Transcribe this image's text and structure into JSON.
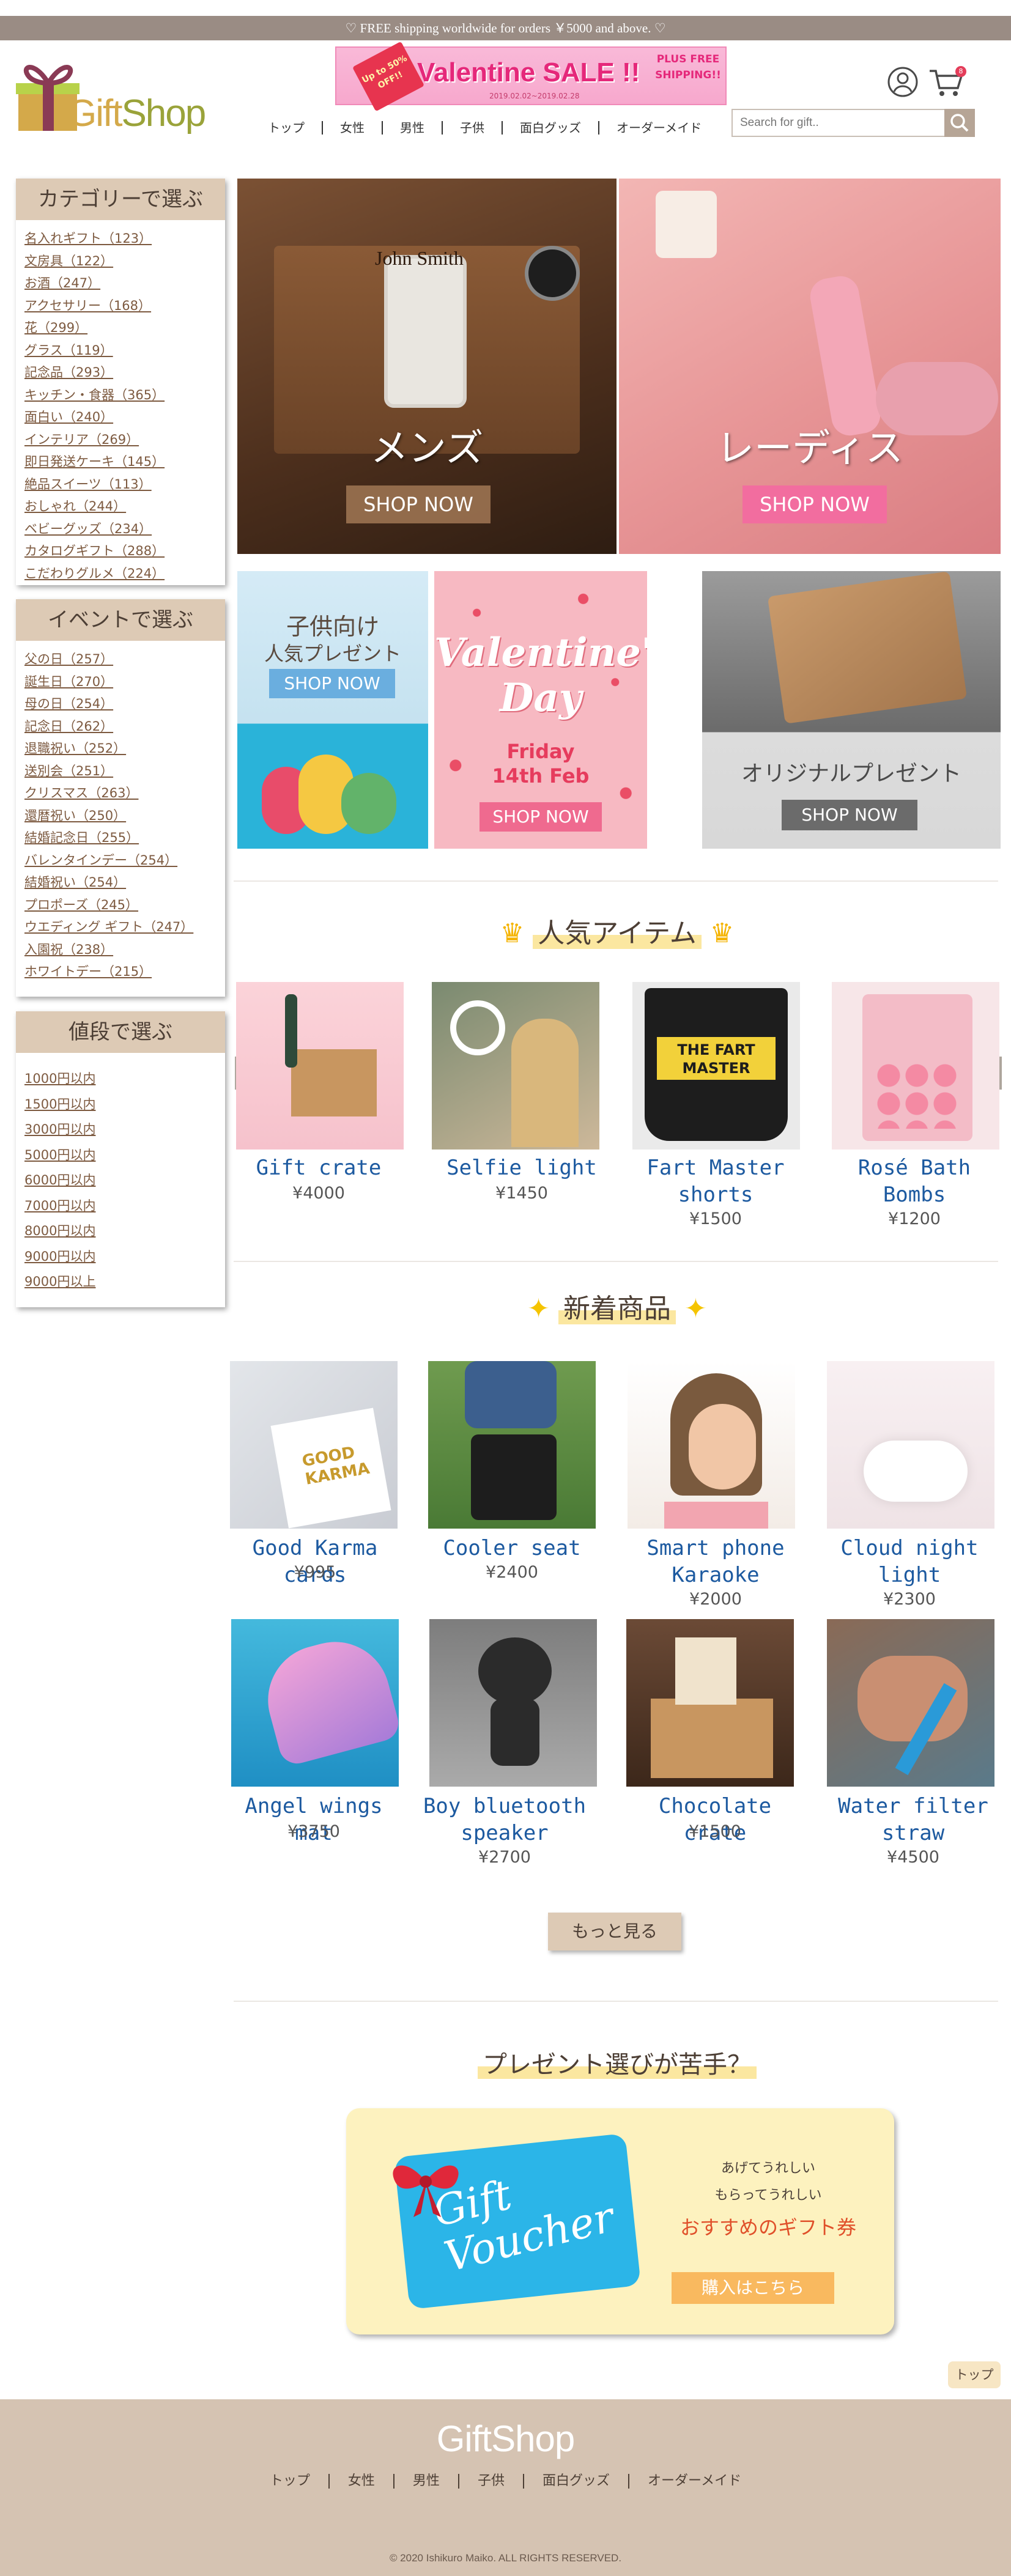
{
  "topbar": {
    "text": "♡ FREE shipping worldwide for orders ￥5000 and above. ♡"
  },
  "header": {
    "logo_text_a": "Gift",
    "logo_text_b": "Shop",
    "banner": {
      "title": "Valentine SALE !!",
      "badge": "Up to 50% OFF!!",
      "dates": "2019.02.02~2019.02.28",
      "plus": "PLUS FREE SHIPPING!!"
    },
    "cart_count": "8",
    "nav": [
      "トップ",
      "女性",
      "男性",
      "子供",
      "面白グッズ",
      "オーダーメイド"
    ],
    "search_placeholder": "Search for gift..",
    "colors": {
      "topbar": "#9a8c84",
      "accent": "#ddcab5",
      "link": "#1d5aa0"
    }
  },
  "sidebar": {
    "categories": {
      "title": "カテゴリーで選ぶ",
      "items": [
        "名入れギフト（123）",
        "文房具（122）",
        "お酒（247）",
        "アクセサリー（168）",
        "花（299）",
        "グラス（119）",
        "記念品（293）",
        "キッチン・食器（365）",
        "面白い（240）",
        "インテリア（269）",
        "即日発送ケーキ（145）",
        "絶品スイーツ（113）",
        "おしゃれ（244）",
        "ベビーグッズ（234）",
        "カタログギフト（288）",
        "こだわりグルメ（224）"
      ]
    },
    "events": {
      "title": "イベントで選ぶ",
      "items": [
        "父の日（257）",
        "誕生日（270）",
        "母の日（254）",
        "記念日（262）",
        "退職祝い（252）",
        "送別会（251）",
        "クリスマス（263）",
        "還暦祝い（250）",
        "結婚記念日（255）",
        "バレンタインデー（254）",
        "結婚祝い（254）",
        "プロポーズ（245）",
        "ウエディング ギフト（247）",
        "入園祝（238）",
        "ホワイトデー（215）"
      ]
    },
    "prices": {
      "title": "値段で選ぶ",
      "items": [
        "1000円以内",
        "1500円以内",
        "3000円以内",
        "5000円以内",
        "6000円以内",
        "7000円以内",
        "8000円以内",
        "9000円以内",
        "9000円以上"
      ]
    }
  },
  "hero": {
    "mens": {
      "label": "メンズ",
      "button": "SHOP NOW",
      "engraving": "John Smith"
    },
    "ladies": {
      "label": "レーディス",
      "button": "SHOP NOW"
    },
    "kids": {
      "line1": "子供向け",
      "line2": "人気プレゼント",
      "button": "SHOP NOW"
    },
    "valentine": {
      "line1": "Valentine's",
      "line2": "Day",
      "date1": "Friday",
      "date2": "14th Feb",
      "button": "SHOP NOW"
    },
    "original": {
      "label": "オリジナルプレゼント",
      "button": "SHOP NOW"
    }
  },
  "popular": {
    "title": "人気アイテム",
    "items": [
      {
        "name": "Gift crate",
        "price": "¥4000"
      },
      {
        "name": "Selfie light",
        "price": "¥1450"
      },
      {
        "name": "Fart Master shorts",
        "price": "¥1500"
      },
      {
        "name": "Rosé Bath Bombs",
        "price": "¥1200"
      }
    ]
  },
  "new_items": {
    "title": "新着商品",
    "items": [
      {
        "name": "Good Karma cards",
        "price": "¥995"
      },
      {
        "name": "Cooler seat",
        "price": "¥2400"
      },
      {
        "name": "Smart phone Karaoke",
        "price": "¥2000"
      },
      {
        "name": "Cloud night light",
        "price": "¥2300"
      },
      {
        "name": "Angel wings mat",
        "price": "¥3750"
      },
      {
        "name": "Boy bluetooth speaker",
        "price": "¥2700"
      },
      {
        "name": "Chocolate crate",
        "price": "¥1500"
      },
      {
        "name": "Water filter straw",
        "price": "¥4500"
      }
    ],
    "more_button": "もっと見る"
  },
  "voucher": {
    "heading": "プレゼント選びが苦手？",
    "card_line1": "Gift",
    "card_line2": "Voucher",
    "line1": "あげてうれしい",
    "line2": "もらってうれしい",
    "line3": "おすすめのギフト券",
    "button": "購入はこちら"
  },
  "top_button": "トップ",
  "footer": {
    "logo": "GiftShop",
    "nav": [
      "トップ",
      "女性",
      "男性",
      "子供",
      "面白グッズ",
      "オーダーメイド"
    ],
    "copyright": "© 2020 Ishikuro Maiko. ALL RIGHTS RESERVED."
  }
}
